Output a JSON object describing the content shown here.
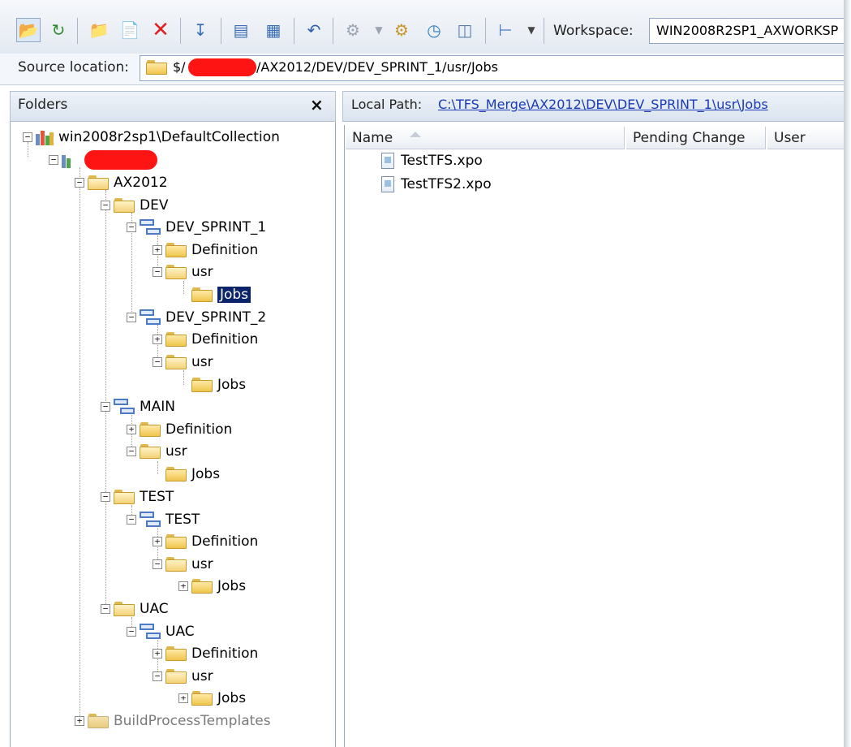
{
  "toolbar": {
    "workspace_label": "Workspace:",
    "workspace_value": "WIN2008R2SP1_AXWORKSP"
  },
  "source": {
    "label": "Source location:",
    "path_prefix": "$/",
    "path_suffix": "/AX2012/DEV/DEV_SPRINT_1/usr/Jobs"
  },
  "folders_panel": {
    "title": "Folders",
    "close": "×"
  },
  "tree": {
    "root": "win2008r2sp1\\DefaultCollection",
    "ax2012": "AX2012",
    "dev": "DEV",
    "dev_sprint_1": "DEV_SPRINT_1",
    "ds1_definition": "Definition",
    "ds1_usr": "usr",
    "ds1_jobs": "Jobs",
    "dev_sprint_2": "DEV_SPRINT_2",
    "ds2_definition": "Definition",
    "ds2_usr": "usr",
    "ds2_jobs": "Jobs",
    "main": "MAIN",
    "main_definition": "Definition",
    "main_usr": "usr",
    "main_jobs": "Jobs",
    "test": "TEST",
    "test_branch": "TEST",
    "test_definition": "Definition",
    "test_usr": "usr",
    "test_jobs": "Jobs",
    "uac": "UAC",
    "uac_branch": "UAC",
    "uac_definition": "Definition",
    "uac_usr": "usr",
    "uac_jobs": "Jobs",
    "build": "BuildProcessTemplates"
  },
  "local_path": {
    "label": "Local Path:",
    "value": "C:\\TFS_Merge\\AX2012\\DEV\\DEV_SPRINT_1\\usr\\Jobs"
  },
  "columns": [
    "Name",
    "Pending Change",
    "User"
  ],
  "files": [
    "TestTFS.xpo",
    "TestTFS2.xpo"
  ]
}
